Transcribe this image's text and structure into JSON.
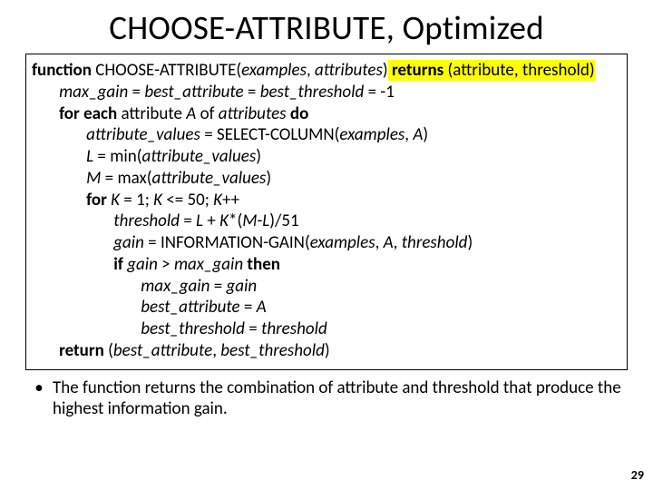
{
  "title": "CHOOSE-ATTRIBUTE, Optimized",
  "code": {
    "l1a": "function ",
    "l1b": "CHOOSE-ATTRIBUTE(",
    "l1c": "examples",
    "l1d": ", ",
    "l1e": "attributes",
    "l1f": ")",
    "l1g": " returns ",
    "l1h": "(attribute, threshold)",
    "l2a": "max_gain",
    "l2b": " = ",
    "l2c": "best_attribute",
    "l2d": " = ",
    "l2e": "best_threshold",
    "l2f": " = -1",
    "l3a": "for each ",
    "l3b": "attribute ",
    "l3c": "A ",
    "l3d": "of ",
    "l3e": "attributes ",
    "l3f": "do",
    "l4a": "attribute_values ",
    "l4b": "= SELECT-COLUMN(",
    "l4c": "examples",
    "l4d": ", ",
    "l4e": "A",
    "l4f": ")",
    "l5a": "L",
    "l5b": " = min(",
    "l5c": "attribute_values",
    "l5d": ")",
    "l6a": "M",
    "l6b": " = max(",
    "l6c": "attribute_values",
    "l6d": ")",
    "l7a": "for ",
    "l7b": "K",
    "l7c": " = 1; ",
    "l7d": "K",
    "l7e": " <= 50; ",
    "l7f": "K",
    "l7g": "++",
    "l8a": "threshold",
    "l8b": " = ",
    "l8c": "L",
    "l8d": " + ",
    "l8e": "K",
    "l8f": "*(",
    "l8g": "M",
    "l8h": "-",
    "l8i": "L",
    "l8j": ")/51",
    "l9a": "gain",
    "l9b": " = INFORMATION-GAIN(",
    "l9c": "examples",
    "l9d": ", ",
    "l9e": "A",
    "l9f": ", ",
    "l9g": "threshold",
    "l9h": ")",
    "l10a": "if ",
    "l10b": "gain",
    "l10c": " > ",
    "l10d": "max_gain",
    "l10e": " then",
    "l11a": "max_gain",
    "l11b": " = ",
    "l11c": "gain",
    "l12a": "best_attribute",
    "l12b": " = ",
    "l12c": "A",
    "l13a": "best_threshold",
    "l13b": " = ",
    "l13c": "threshold",
    "l14a": "return ",
    "l14b": "(",
    "l14c": "best_attribute",
    "l14d": ", ",
    "l14e": "best_threshold",
    "l14f": ")"
  },
  "bullet": {
    "dot": "•",
    "text": "The function returns the combination of attribute and threshold that produce the highest information gain."
  },
  "pagenum": "29"
}
